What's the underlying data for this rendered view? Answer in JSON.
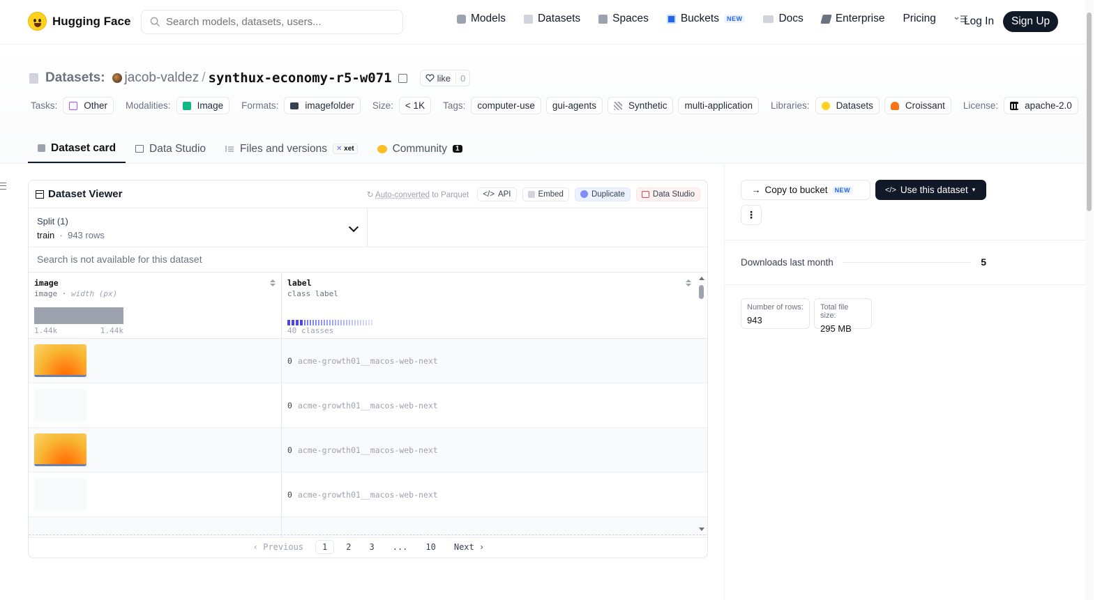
{
  "header": {
    "brand": "Hugging Face",
    "search_placeholder": "Search models, datasets, users...",
    "nav": [
      {
        "label": "Models",
        "icon": "models-icon",
        "color": "#9ca3af"
      },
      {
        "label": "Datasets",
        "icon": "datasets-icon",
        "color": "#d1d5db"
      },
      {
        "label": "Spaces",
        "icon": "spaces-icon",
        "color": "#9ca3af"
      },
      {
        "label": "Buckets",
        "icon": "buckets-icon",
        "color": "#2563eb",
        "badge": "NEW"
      },
      {
        "label": "Docs",
        "icon": "docs-icon",
        "color": "#9ca3af"
      },
      {
        "label": "Enterprise",
        "icon": "enterprise-icon",
        "color": "#6b7280"
      },
      {
        "label": "Pricing"
      }
    ],
    "login": "Log In",
    "signup": "Sign Up"
  },
  "repo": {
    "crumb": "Datasets:",
    "owner": "jacob-valdez",
    "sep": "/",
    "name": "synthux-economy-r5-w071",
    "like_label": "like",
    "like_count": "0"
  },
  "tags": {
    "tasks_label": "Tasks:",
    "tasks": [
      "Other"
    ],
    "modalities_label": "Modalities:",
    "modalities": [
      "Image"
    ],
    "formats_label": "Formats:",
    "formats": [
      "imagefolder"
    ],
    "size_label": "Size:",
    "size": [
      "< 1K"
    ],
    "tags_label": "Tags:",
    "tags": [
      "computer-use",
      "gui-agents",
      "Synthetic",
      "multi-application"
    ],
    "libraries_label": "Libraries:",
    "libraries": [
      "Datasets",
      "Croissant"
    ],
    "license_label": "License:",
    "license": [
      "apache-2.0"
    ]
  },
  "tabs": [
    {
      "label": "Dataset card",
      "active": true
    },
    {
      "label": "Data Studio"
    },
    {
      "label": "Files and versions",
      "badge": "xet"
    },
    {
      "label": "Community",
      "count": "1"
    }
  ],
  "viewer": {
    "title": "Dataset Viewer",
    "auto_converted": "Auto-converted",
    "auto_suffix": " to Parquet",
    "actions": [
      "API",
      "Embed",
      "Duplicate",
      "Data Studio"
    ],
    "split_label": "Split (1)",
    "split_value": "train",
    "split_rows": "943 rows",
    "search_disabled": "Search is not available for this dataset",
    "columns": [
      {
        "name": "image",
        "type": "image",
        "subtype": "width (px)",
        "min": "1.44k",
        "max": "1.44k"
      },
      {
        "name": "label",
        "type": "class label",
        "classes": "40 classes"
      }
    ],
    "rows": [
      {
        "image": "wallpaper-thumbnail",
        "index": "0",
        "label": "acme-growth01__macos-web-next"
      },
      {
        "image": "blank-thumbnail",
        "index": "0",
        "label": "acme-growth01__macos-web-next"
      },
      {
        "image": "wallpaper-thumbnail",
        "index": "0",
        "label": "acme-growth01__macos-web-next"
      },
      {
        "image": "blank-thumbnail",
        "index": "0",
        "label": "acme-growth01__macos-web-next"
      }
    ],
    "pagination": {
      "prev": "Previous",
      "pages": [
        "1",
        "2",
        "3",
        "...",
        "10"
      ],
      "current": "1",
      "next": "Next"
    }
  },
  "sidebar": {
    "copy_bucket": "Copy to bucket",
    "copy_bucket_badge": "NEW",
    "use_dataset": "Use this dataset",
    "more": "⋮",
    "downloads_label": "Downloads last month",
    "downloads_value": "5",
    "rows_label": "Number of rows:",
    "rows_value": "943",
    "size_label": "Total file size:",
    "size_value": "295 MB"
  }
}
